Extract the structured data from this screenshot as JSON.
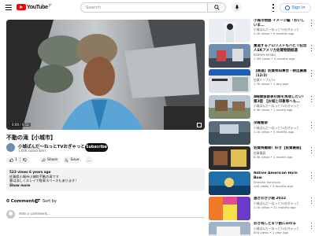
{
  "header": {
    "logo_text": "YouTube",
    "logo_region": "JP",
    "search_placeholder": "Search",
    "signin_label": "Sign in"
  },
  "player": {
    "time": "0:00 / 0:12",
    "end_card": "Video will play\nafter ad"
  },
  "video": {
    "title": "不動の滝【小城市】",
    "channel_name": "小城ぱんだ〜ねっとTVおぎゃっと",
    "channel_subs": "1.60K subscribers",
    "subscribe_label": "Subscribe",
    "like_count": "1",
    "share_label": "Share",
    "save_label": "Save",
    "more_label": "…"
  },
  "description": {
    "stats": "523 views  6 years ago",
    "line1": "佐賀県小城市小城町不動の滝です",
    "line2": "夏は涼しくキレイで駐車スペースもあります！",
    "more": "Show more"
  },
  "comments": {
    "count_label": "0 Comments",
    "sort_label": "Sort by",
    "placeholder": "Add a comment..."
  },
  "colors": {
    "brand": "#ff0000",
    "link": "#065fd4",
    "text": "#0f0f0f",
    "secondary_text": "#606060",
    "chip_bg": "#f2f2f2"
  },
  "recommendations": [
    {
      "title": "小城市物語 イメージ編「おいしいま…",
      "channel": "小城ぱんだ〜ねっとTVおぎゃっと",
      "meta": "3.2K views • 6 months ago",
      "badge": ""
    },
    {
      "title": "重道するアロリストもハビリ記念人SKアメリカ佐賀物語経過",
      "channel": "SEBRAY-RESBG",
      "meta": "1.3M views • 4 months ago",
      "badge": ""
    },
    {
      "title": "【報道】佐賀県知事会・朝出農業（12/3）",
      "channel": "佐賀ケーブルTV",
      "meta": "1.7K views • 1 day ago",
      "badge": "New"
    },
    {
      "title": "4時間抜群表の開を再現したい！第3話 【お城と印象等へも…",
      "channel": "小城ぱんだ〜ねっとTVおぎゃっと",
      "meta": "9.9K views • 1 month ago",
      "badge": "New"
    },
    {
      "title": "小城警部",
      "channel": "小城ぱんだ〜ねっとTVおぎゃっと",
      "meta": "1.1K views • 5 months ago",
      "badge": ""
    },
    {
      "title": "佐賀県難関！好き【佐賀最弱】",
      "channel": "佐賀最弱",
      "meta": "6.3K views • 1 month ago",
      "badge": ""
    },
    {
      "title": "Native American Horn Bow",
      "channel": "Shinyan Survivors",
      "meta": "14K views • 3 months ago",
      "badge": ""
    },
    {
      "title": "過ぎのき小城 2022",
      "channel": "小城ぱんだ〜ねっとTVおぎゃっと",
      "meta": "1.1K views • 11 months ago",
      "badge": ""
    },
    {
      "title": "おきぬしとまり割にみのる",
      "channel": "小城ぱんだ〜ねっとTVおぎゃっと",
      "meta": "834 views • 1 year ago",
      "badge": ""
    }
  ]
}
